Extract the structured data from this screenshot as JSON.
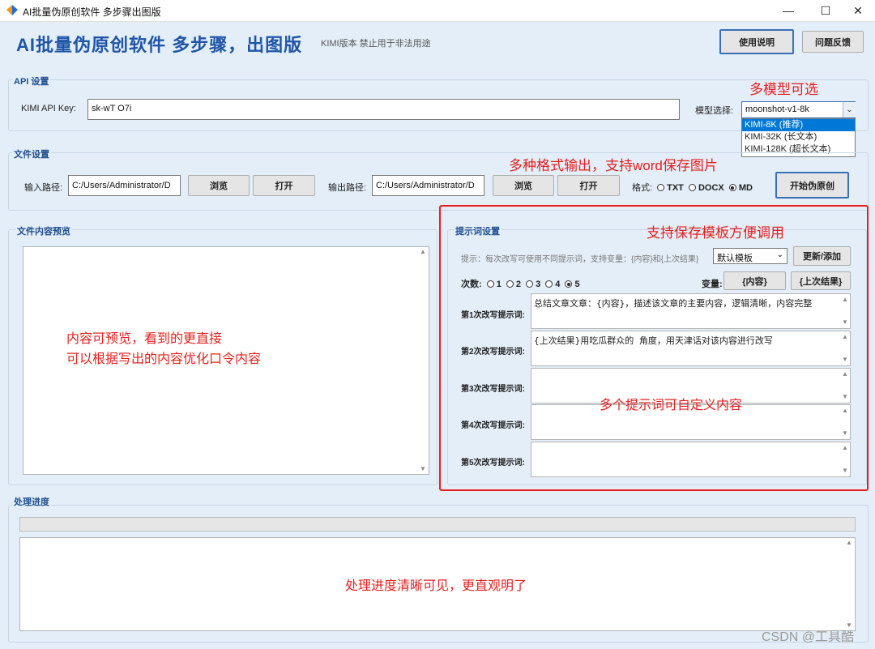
{
  "window": {
    "title": "AI批量伪原创软件 多步骤出图版",
    "minimize_glyph": "—",
    "maximize_glyph": "☐",
    "close_glyph": "✕"
  },
  "header": {
    "title": "AI批量伪原创软件 多步骤，出图版",
    "subtitle": "KIMI版本 禁止用于非法用途",
    "manual_button": "使用说明",
    "feedback_button": "问题反馈"
  },
  "api_settings": {
    "group_label": "API 设置",
    "key_label": "KIMI API Key:",
    "key_value": "sk-wT                                                         O7i",
    "model_label": "模型选择:",
    "model_selected": "moonshot-v1-8k",
    "model_options": [
      "KIMI-8K (推荐)",
      "KIMI-32K (长文本)",
      "KIMI-128K (超长文本)"
    ]
  },
  "file_settings": {
    "group_label": "文件设置",
    "input_label": "输入路径:",
    "input_value": "C:/Users/Administrator/D",
    "browse": "浏览",
    "open": "打开",
    "output_label": "输出路径:",
    "output_value": "C:/Users/Administrator/D",
    "format_label": "格式:",
    "formats": [
      "TXT",
      "DOCX",
      "MD"
    ],
    "format_selected": "MD",
    "start_button": "开始伪原创"
  },
  "preview": {
    "group_label": "文件内容预览"
  },
  "prompt_settings": {
    "group_label": "提示词设置",
    "hint": "提示：每次改写可使用不同提示词，支持变量：{内容}和{上次结果}",
    "template_selected": "默认模板",
    "update_button": "更新/添加",
    "times_label": "次数:",
    "times_options": [
      "1",
      "2",
      "3",
      "4",
      "5"
    ],
    "times_selected": "5",
    "variables_label": "变量:",
    "var_content": "{内容}",
    "var_last": "{上次结果}",
    "prompts": [
      {
        "label": "第1次改写提示词:",
        "value": "总结文章文章：{内容}，描述该文章的主要内容，逻辑清晰，内容完整"
      },
      {
        "label": "第2次改写提示词:",
        "value": "{上次结果}用吃瓜群众的 角度，用天津话对该内容进行改写"
      },
      {
        "label": "第3次改写提示词:",
        "value": ""
      },
      {
        "label": "第4次改写提示词:",
        "value": ""
      },
      {
        "label": "第5次改写提示词:",
        "value": ""
      }
    ]
  },
  "progress": {
    "group_label": "处理进度",
    "percent": 0
  },
  "annotations": {
    "multi_model": "多模型可选",
    "formats": "多种格式输出，支持word保存图片",
    "templates": "支持保存模板方便调用",
    "preview_line1": "内容可预览，看到的更直接",
    "preview_line2": "可以根据写出的内容优化口令内容",
    "prompts": "多个提示词可自定义内容",
    "progress": "处理进度清晰可见，更直观明了"
  },
  "watermark": "CSDN @工具酷",
  "colors": {
    "background": "#e3eef8",
    "title_blue": "#1f55a6",
    "annotation_red": "#e62020",
    "highlight_box": "#e62020"
  }
}
